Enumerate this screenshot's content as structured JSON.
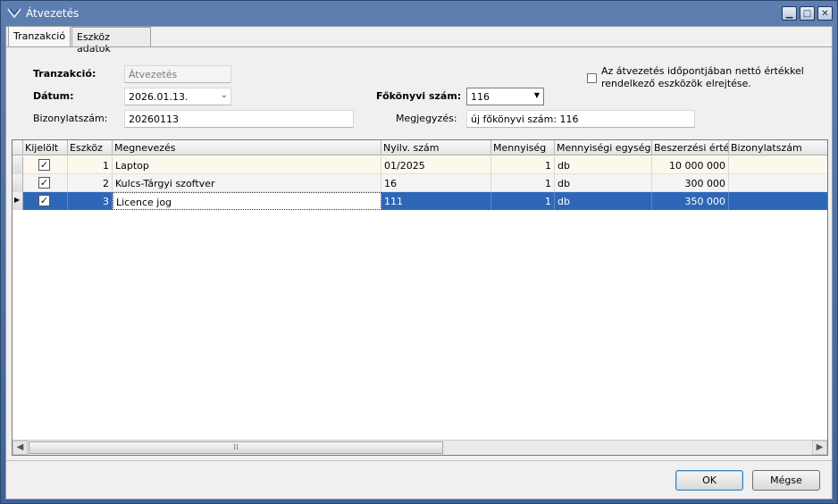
{
  "window": {
    "title": "Átvezetés"
  },
  "tabs": [
    {
      "label": "Tranzakció"
    },
    {
      "label": "Eszköz adatok"
    }
  ],
  "form": {
    "tranzakcio_label": "Tranzakció:",
    "tranzakcio_value": "Átvezetés",
    "datum_label": "Dátum:",
    "datum_value": "2026.01.13.",
    "fokonyvi_label": "Főkönyvi szám:",
    "fokonyvi_value": "116",
    "bizonylat_label": "Bizonylatszám:",
    "bizonylat_value": "20260113",
    "megjegyzes_label": "Megjegyzés:",
    "megjegyzes_value": "új főkönyvi szám: 116",
    "checkbox_label_line1": "Az átvezetés időpontjában nettó értékkel",
    "checkbox_label_line2": "rendelkező eszközök elrejtése.",
    "checkbox_checked": false
  },
  "grid": {
    "columns": [
      "Kijelölt",
      "Eszköz",
      "Megnevezés",
      "Nyilv. szám",
      "Mennyiség",
      "Mennyiségi egység",
      "Beszerzési érték",
      "Bizonylatszám"
    ],
    "rows": [
      {
        "checked": true,
        "eszkoz": "1",
        "megnevezes": "Laptop",
        "nyilv": "01/2025",
        "mennyiseg": "1",
        "egyseg": "db",
        "ertek": "10 000 000",
        "bizonylat": ""
      },
      {
        "checked": true,
        "eszkoz": "2",
        "megnevezes": "Kulcs-Tárgyi szoftver",
        "nyilv": "16",
        "mennyiseg": "1",
        "egyseg": "db",
        "ertek": "300 000",
        "bizonylat": ""
      },
      {
        "checked": true,
        "eszkoz": "3",
        "megnevezes": "Licence jog",
        "nyilv": "111",
        "mennyiseg": "1",
        "egyseg": "db",
        "ertek": "350 000",
        "bizonylat": ""
      }
    ],
    "selected_row": 2
  },
  "buttons": {
    "ok": "OK",
    "cancel": "Mégse"
  },
  "colors": {
    "titlebar": "#4a6da3",
    "selection": "#2f67b8",
    "row_alt": "#fdf8ec"
  }
}
